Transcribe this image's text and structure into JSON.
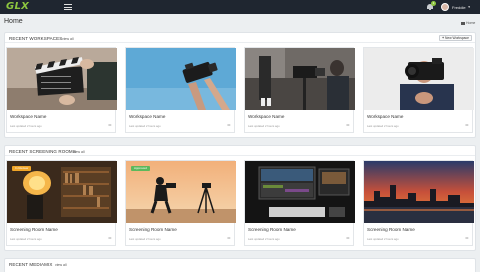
{
  "app": {
    "logo": "GLX",
    "user_name": "Freddie",
    "notification_count": "1"
  },
  "page": {
    "title": "Home",
    "breadcrumb": "Home"
  },
  "workspaces": {
    "title": "RECENT WORKSPACES",
    "view_all": "view all",
    "new_button": "New Workspace",
    "cards": [
      {
        "name": "Workspace Name",
        "sub": "Last updated 2 hours ago",
        "image": "clapperboard"
      },
      {
        "name": "Workspace Name",
        "sub": "Last updated 2 hours ago",
        "image": "camera-sky"
      },
      {
        "name": "Workspace Name",
        "sub": "Last updated 2 hours ago",
        "image": "film-set"
      },
      {
        "name": "Workspace Name",
        "sub": "Last updated 2 hours ago",
        "image": "cameraman"
      }
    ]
  },
  "screening": {
    "title": "RECENT SCREENING ROOMS",
    "view_all": "view all",
    "cards": [
      {
        "name": "Screening Room Name",
        "sub": "Last updated 2 hours ago",
        "image": "library",
        "tag": "In Review",
        "tag_color": "#f0a528"
      },
      {
        "name": "Screening Room Name",
        "sub": "Last updated 2 hours ago",
        "image": "tripod-sunset",
        "tag": "Approved",
        "tag_color": "#5cb85c"
      },
      {
        "name": "Screening Room Name",
        "sub": "Last updated 2 hours ago",
        "image": "editing-desk"
      },
      {
        "name": "Screening Room Name",
        "sub": "Last updated 2 hours ago",
        "image": "city-sunset"
      }
    ]
  },
  "mediamix": {
    "title": "RECENT MEDIAMIX",
    "view_all": "view all"
  },
  "colors": {
    "topbar": "#1f2630",
    "brand": "#8dc63f",
    "background": "#eceff1"
  }
}
